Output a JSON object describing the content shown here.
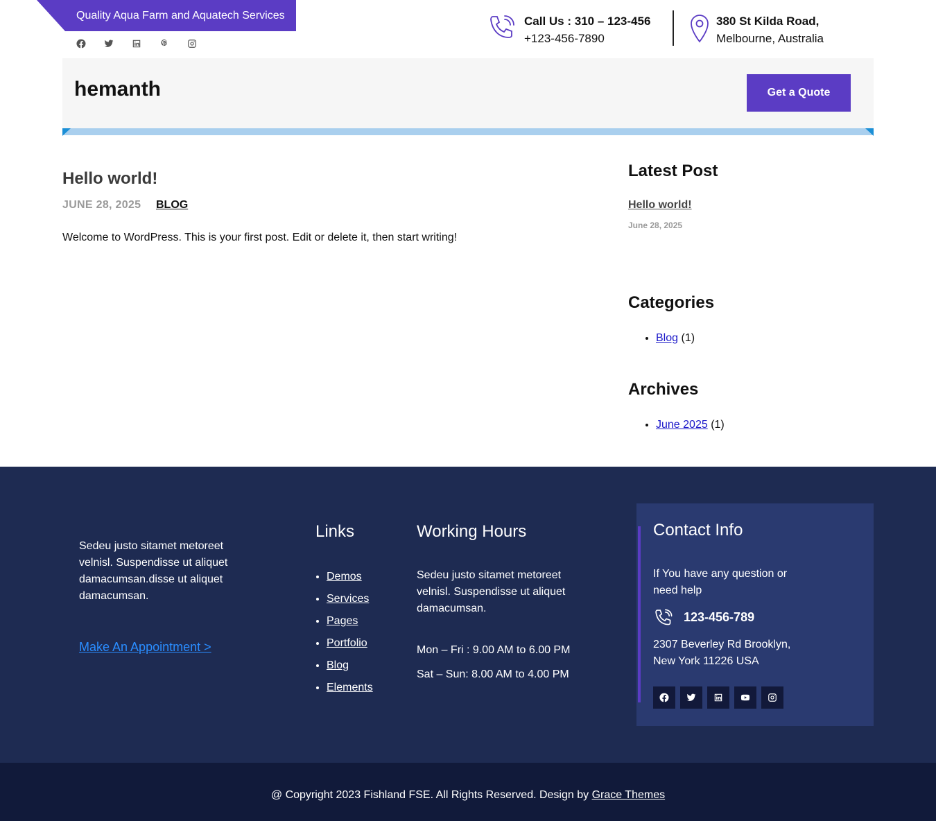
{
  "topbar": {
    "tagline": "Quality Aqua Farm and Aquatech Services",
    "socials": [
      "facebook-icon",
      "twitter-icon",
      "linkedin-icon",
      "pinterest-icon",
      "instagram-icon"
    ],
    "call_label": "Call Us : 310 – 123-456",
    "call_number": "+123-456-7890",
    "address_line1": "380 St Kilda Road,",
    "address_line2": "Melbourne, Australia"
  },
  "header": {
    "site_title": "hemanth",
    "quote_button": "Get a Quote"
  },
  "post": {
    "title": "Hello world!",
    "date": "JUNE 28, 2025",
    "category": "BLOG",
    "body": "Welcome to WordPress. This is your first post. Edit or delete it, then start writing!"
  },
  "sidebar": {
    "latest_heading": "Latest Post",
    "latest_post_title": "Hello world!",
    "latest_post_date": "June 28, 2025",
    "categories_heading": "Categories",
    "category_name": "Blog",
    "category_count": "(1)",
    "archives_heading": "Archives",
    "archive_name": "June 2025",
    "archive_count": "(1)"
  },
  "footer": {
    "about_text": "Sedeu justo sitamet metoreet velnisl. Suspendisse ut aliquet damacumsan.disse ut aliquet damacumsan.",
    "appointment_link": "Make An Appointment >",
    "links_heading": "Links",
    "links": [
      "Demos",
      "Services",
      "Pages",
      "Portfolio",
      "Blog",
      "Elements"
    ],
    "hours_heading": "Working Hours",
    "hours_text": "Sedeu justo sitamet metoreet velnisl. Suspendisse ut aliquet damacumsan.",
    "hours_weekday": "Mon – Fri : 9.00 AM to 6.00 PM",
    "hours_weekend": "Sat – Sun: 8.00 AM to 4.00 PM",
    "contact_heading": "Contact Info",
    "contact_question": "If You have any question or need help",
    "contact_phone": "123-456-789",
    "contact_address": "2307 Beverley Rd Brooklyn, New York 11226 USA",
    "contact_socials": [
      "facebook-icon",
      "twitter-icon",
      "linkedin-icon",
      "youtube-icon",
      "instagram-icon"
    ],
    "copyright_prefix": "@ Copyright 2023 Fishland FSE. All Rights Reserved. Design by",
    "copyright_link": "Grace Themes"
  },
  "colors": {
    "accent": "#5b3cc4",
    "footer_bg": "#1e2b52",
    "bottombar_bg": "#111a3a",
    "link_blue": "#1a17c9",
    "appointment_blue": "#2a8dff"
  }
}
